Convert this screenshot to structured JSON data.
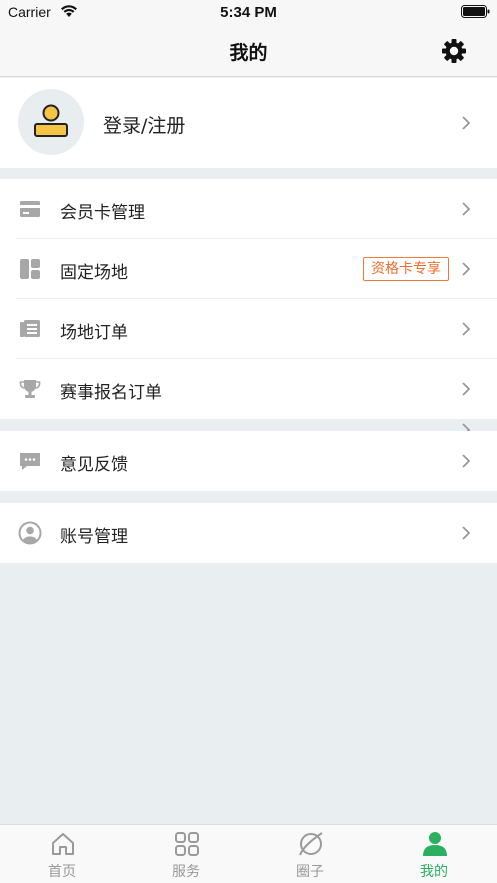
{
  "status_bar": {
    "carrier": "Carrier",
    "time": "5:34 PM"
  },
  "nav": {
    "title": "我的"
  },
  "profile": {
    "login_label": "登录/注册"
  },
  "menu_group_1": [
    {
      "label": "会员卡管理",
      "icon": "card-icon"
    },
    {
      "label": "固定场地",
      "icon": "layout-icon",
      "badge": "资格卡专享"
    },
    {
      "label": "场地订单",
      "icon": "orders-icon"
    },
    {
      "label": "赛事报名订单",
      "icon": "trophy-icon"
    }
  ],
  "menu_group_2": [
    {
      "label": "意见反馈",
      "icon": "chat-icon"
    }
  ],
  "menu_group_3": [
    {
      "label": "账号管理",
      "icon": "account-icon"
    }
  ],
  "tabs": [
    {
      "label": "首页",
      "icon": "home-icon"
    },
    {
      "label": "服务",
      "icon": "grid-icon"
    },
    {
      "label": "圈子",
      "icon": "planet-icon"
    },
    {
      "label": "我的",
      "icon": "person-icon",
      "active": true
    }
  ],
  "colors": {
    "accent": "#2ab05f",
    "badge": "#ee6d2e",
    "background": "#e9eef1",
    "avatar_icon": "#f6c445"
  }
}
